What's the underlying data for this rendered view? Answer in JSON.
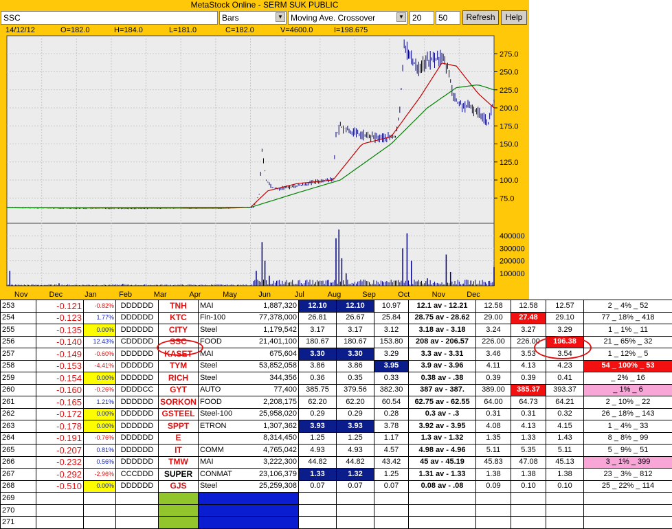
{
  "window": {
    "title": "MetaStock Online - SERM SUK PUBLIC"
  },
  "toolbar": {
    "symbol": "SSC",
    "chart_type": "Bars",
    "indicator": "Moving Ave. Crossover",
    "period1": "20",
    "period2": "50",
    "refresh_label": "Refresh",
    "help_label": "Help",
    "dropdown_icon": "triangle-down-icon"
  },
  "quote": {
    "date": "14/12/12",
    "open": "O=182.0",
    "high": "H=184.0",
    "low": "L=181.0",
    "close": "C=182.0",
    "volume": "V=4600.0",
    "i": "I=198.675"
  },
  "chart_data": {
    "type": "line",
    "price_axis_ticks": [
      "275.0",
      "250.0",
      "225.0",
      "200.0",
      "175.0",
      "150.0",
      "125.0",
      "100.0",
      "75.0"
    ],
    "volume_axis_ticks": [
      "400000",
      "300000",
      "200000",
      "100000"
    ],
    "months": [
      "Nov",
      "Dec",
      "Jan",
      "Feb",
      "Mar",
      "Apr",
      "May",
      "Jun",
      "Jul",
      "Aug",
      "Sep",
      "Oct",
      "Nov",
      "Dec"
    ],
    "price_ylim": [
      40,
      300
    ],
    "volume_ylim": [
      0,
      500000
    ],
    "price_anchors": [
      [
        0,
        62
      ],
      [
        30,
        61
      ],
      [
        60,
        60.5
      ],
      [
        90,
        60.5
      ],
      [
        120,
        61
      ],
      [
        150,
        61
      ],
      [
        170,
        62
      ],
      [
        174,
        80
      ],
      [
        176,
        140
      ],
      [
        179,
        100
      ],
      [
        183,
        90
      ],
      [
        188,
        88
      ],
      [
        200,
        92
      ],
      [
        215,
        98
      ],
      [
        225,
        102
      ],
      [
        227,
        160
      ],
      [
        230,
        175
      ],
      [
        240,
        165
      ],
      [
        250,
        160
      ],
      [
        260,
        158
      ],
      [
        268,
        160
      ],
      [
        271,
        195
      ],
      [
        274,
        290
      ],
      [
        278,
        270
      ],
      [
        284,
        255
      ],
      [
        290,
        265
      ],
      [
        300,
        270
      ],
      [
        305,
        250
      ],
      [
        308,
        215
      ],
      [
        312,
        205
      ],
      [
        320,
        200
      ],
      [
        328,
        190
      ],
      [
        332,
        180
      ],
      [
        336,
        210
      ]
    ],
    "ma20_anchors": [
      [
        0,
        61.5
      ],
      [
        150,
        61
      ],
      [
        168,
        62
      ],
      [
        180,
        85
      ],
      [
        200,
        95
      ],
      [
        225,
        100
      ],
      [
        245,
        150
      ],
      [
        265,
        160
      ],
      [
        285,
        215
      ],
      [
        300,
        262
      ],
      [
        310,
        258
      ],
      [
        325,
        220
      ],
      [
        336,
        200
      ]
    ],
    "ma50_anchors": [
      [
        0,
        61.5
      ],
      [
        168,
        62
      ],
      [
        200,
        82
      ],
      [
        230,
        100
      ],
      [
        265,
        150
      ],
      [
        290,
        200
      ],
      [
        310,
        228
      ],
      [
        325,
        232
      ],
      [
        336,
        225
      ]
    ],
    "volume_spikes": [
      [
        2,
        120000
      ],
      [
        36,
        20000
      ],
      [
        80,
        15000
      ],
      [
        172,
        120000
      ],
      [
        176,
        350000
      ],
      [
        178,
        200000
      ],
      [
        181,
        80000
      ],
      [
        227,
        380000
      ],
      [
        229,
        450000
      ],
      [
        231,
        220000
      ],
      [
        234,
        100000
      ],
      [
        273,
        300000
      ],
      [
        276,
        420000
      ],
      [
        279,
        200000
      ],
      [
        290,
        60000
      ],
      [
        303,
        250000
      ],
      [
        306,
        110000
      ],
      [
        320,
        40000
      ],
      [
        336,
        150000
      ]
    ],
    "series": [
      {
        "name": "",
        "color": "#000080"
      },
      {
        "name": "",
        "color": "#c00000"
      },
      {
        "name": "",
        "color": "#008000"
      }
    ]
  },
  "table": {
    "rows": [
      {
        "n": "253",
        "sc": "-0.121",
        "pc": "-0.82%",
        "pcc": "#e01010",
        "code": "DDDDDD",
        "sym": "TNH",
        "sect": "MAI",
        "vol": "1,887,320",
        "p1": "12.10",
        "p2": "12.10",
        "p3": "10.97",
        "avg": "12.1  av - 12.21",
        "x1": "12.58",
        "x2": "12.58",
        "x3": "12.57",
        "tail": "2 _ 4% _ 52",
        "h": {
          "p1": "blue",
          "p2": "blue"
        }
      },
      {
        "n": "254",
        "sc": "-0.123",
        "pc": "1.77%",
        "pcc": "#1020c0",
        "code": "DDDDDD",
        "sym": "KTC",
        "sect": "Fin-100",
        "vol": "77,378,000",
        "p1": "26.81",
        "p2": "26.67",
        "p3": "25.84",
        "avg": "28.75  av - 28.62",
        "x1": "29.00",
        "x2": "27.48",
        "x3": "29.10",
        "tail": "77 _ 18% _ 418",
        "h": {
          "x2": "red"
        }
      },
      {
        "n": "255",
        "sc": "-0.135",
        "pc": "0.00%",
        "pcc": "#1020c0",
        "code": "DDDDDD",
        "sym": "CITY",
        "sect": "Steel",
        "vol": "1,179,542",
        "p1": "3.17",
        "p2": "3.17",
        "p3": "3.12",
        "avg": "3.18  av - 3.18",
        "x1": "3.24",
        "x2": "3.27",
        "x3": "3.29",
        "tail": "1 _ 1% _ 11",
        "h": {
          "pc": "yellow"
        }
      },
      {
        "n": "256",
        "sc": "-0.140",
        "pc": "12.43%",
        "pcc": "#1020c0",
        "code": "CDDDDD",
        "sym": "SSC",
        "sect": "FOOD",
        "vol": "21,401,100",
        "p1": "180.67",
        "p2": "180.67",
        "p3": "153.80",
        "avg": "208  av - 206.57",
        "x1": "226.00",
        "x2": "226.00",
        "x3": "196.38",
        "tail": "21 _ 65% _ 32",
        "h": {
          "x3": "red"
        }
      },
      {
        "n": "257",
        "sc": "-0.149",
        "pc": "-0.60%",
        "pcc": "#e01010",
        "code": "DDDDDD",
        "sym": "KASET",
        "sect": "MAI",
        "vol": "675,604",
        "p1": "3.30",
        "p2": "3.30",
        "p3": "3.29",
        "avg": "3.3  av - 3.31",
        "x1": "3.46",
        "x2": "3.53",
        "x3": "3.54",
        "tail": "1 _ 12% _ 5",
        "h": {
          "p1": "blue",
          "p2": "blue"
        }
      },
      {
        "n": "258",
        "sc": "-0.153",
        "pc": "-4.41%",
        "pcc": "#e01010",
        "code": "DDDDDD",
        "sym": "TYM",
        "sect": "Steel",
        "vol": "53,852,058",
        "p1": "3.86",
        "p2": "3.86",
        "p3": "3.95",
        "avg": "3.9  av - 3.96",
        "x1": "4.11",
        "x2": "4.13",
        "x3": "4.23",
        "tail": "54 _ 100% _ 53",
        "h": {
          "p3": "blue",
          "tail": "red"
        }
      },
      {
        "n": "259",
        "sc": "-0.154",
        "pc": "0.00%",
        "pcc": "#1020c0",
        "code": "DDDDDD",
        "sym": "RICH",
        "sect": "Steel",
        "vol": "344,356",
        "p1": "0.36",
        "p2": "0.35",
        "p3": "0.33",
        "avg": "0.38  av - .38",
        "x1": "0.39",
        "x2": "0.39",
        "x3": "0.41",
        "tail": "_ 2% _ 16",
        "h": {
          "pc": "yellow"
        }
      },
      {
        "n": "260",
        "sc": "-0.160",
        "pc": "-0.26%",
        "pcc": "#e01010",
        "code": "DDDDCC",
        "sym": "GYT",
        "sect": "AUTO",
        "vol": "77,400",
        "p1": "385.75",
        "p2": "379.56",
        "p3": "382.30",
        "avg": "387  av - 387.",
        "x1": "389.00",
        "x2": "385.37",
        "x3": "393.37",
        "tail": "_ 1% _ 6",
        "h": {
          "x2": "red",
          "tail": "pink"
        }
      },
      {
        "n": "261",
        "sc": "-0.165",
        "pc": "1.21%",
        "pcc": "#1020c0",
        "code": "DDDDDD",
        "sym": "SORKON",
        "sect": "FOOD",
        "vol": "2,208,175",
        "p1": "62.20",
        "p2": "62.20",
        "p3": "60.54",
        "avg": "62.75  av - 62.55",
        "x1": "64.00",
        "x2": "64.73",
        "x3": "64.21",
        "tail": "2 _ 10% _ 22",
        "h": {}
      },
      {
        "n": "262",
        "sc": "-0.172",
        "pc": "0.00%",
        "pcc": "#1020c0",
        "code": "DDDDDD",
        "sym": "GSTEEL",
        "sect": "Steel-100",
        "vol": "25,958,020",
        "p1": "0.29",
        "p2": "0.29",
        "p3": "0.28",
        "avg": "0.3  av - .3",
        "x1": "0.31",
        "x2": "0.31",
        "x3": "0.32",
        "tail": "26 _ 18% _ 143",
        "h": {
          "pc": "yellow"
        }
      },
      {
        "n": "263",
        "sc": "-0.178",
        "pc": "0.00%",
        "pcc": "#1020c0",
        "code": "DDDDDD",
        "sym": "SPPT",
        "sect": "ETRON",
        "vol": "1,307,362",
        "p1": "3.93",
        "p2": "3.93",
        "p3": "3.78",
        "avg": "3.92  av - 3.95",
        "x1": "4.08",
        "x2": "4.13",
        "x3": "4.15",
        "tail": "1 _ 4% _ 33",
        "h": {
          "pc": "yellow",
          "p1": "blue",
          "p2": "blue"
        }
      },
      {
        "n": "264",
        "sc": "-0.191",
        "pc": "-0.76%",
        "pcc": "#e01010",
        "code": "DDDDDD",
        "sym": "E",
        "sect": "",
        "vol": "8,314,450",
        "p1": "1.25",
        "p2": "1.25",
        "p3": "1.17",
        "avg": "1.3  av - 1.32",
        "x1": "1.35",
        "x2": "1.33",
        "x3": "1.43",
        "tail": "8 _ 8% _ 99",
        "h": {}
      },
      {
        "n": "265",
        "sc": "-0.207",
        "pc": "0.81%",
        "pcc": "#1020c0",
        "code": "DDDDDD",
        "sym": "IT",
        "sect": "COMM",
        "vol": "4,765,042",
        "p1": "4.93",
        "p2": "4.93",
        "p3": "4.57",
        "avg": "4.98  av - 4.96",
        "x1": "5.11",
        "x2": "5.35",
        "x3": "5.11",
        "tail": "5 _ 9% _ 51",
        "h": {}
      },
      {
        "n": "266",
        "sc": "-0.232",
        "pc": "0.56%",
        "pcc": "#1020c0",
        "code": "DDDDDD",
        "sym": "TMW",
        "sect": "MAI",
        "vol": "3,222,300",
        "p1": "44.82",
        "p2": "44.82",
        "p3": "43.42",
        "avg": "45  av - 45.19",
        "x1": "45.83",
        "x2": "47.08",
        "x3": "45.13",
        "tail": "3 _ 1% _ 399",
        "h": {
          "tail": "pink"
        }
      },
      {
        "n": "267",
        "sc": "-0.292",
        "pc": "-2.96%",
        "pcc": "#e01010",
        "code": "CCCDDD",
        "sym": "SUPER",
        "sect": "CONMAT",
        "vol": "23,106,379",
        "p1": "1.33",
        "p2": "1.32",
        "p3": "1.25",
        "avg": "1.31  av - 1.33",
        "x1": "1.38",
        "x2": "1.38",
        "x3": "1.38",
        "tail": "23 _ 3% _ 812",
        "h": {
          "p1": "blue",
          "p2": "blue"
        },
        "symc": "#000"
      },
      {
        "n": "268",
        "sc": "-0.510",
        "pc": "0.00%",
        "pcc": "#1020c0",
        "code": "DDDDDD",
        "sym": "GJS",
        "sect": "Steel",
        "vol": "25,259,308",
        "p1": "0.07",
        "p2": "0.07",
        "p3": "0.07",
        "avg": "0.08  av - .08",
        "x1": "0.09",
        "x2": "0.10",
        "x3": "0.10",
        "tail": "25 _ 22% _ 114",
        "h": {
          "pc": "yellow"
        }
      }
    ],
    "empty_rows": [
      "269",
      "270",
      "271"
    ]
  },
  "highlight_circles": [
    "SSC",
    "196.38"
  ]
}
